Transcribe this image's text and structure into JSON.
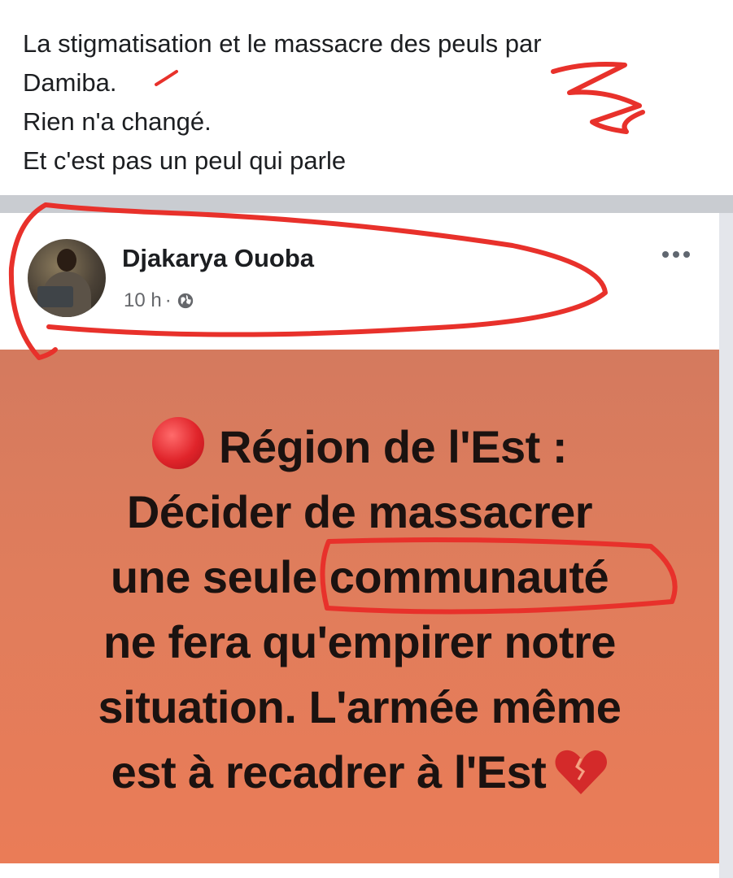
{
  "caption": {
    "lines": [
      "La stigmatisation et le massacre des peuls par",
      "Damiba.",
      "Rien n'a changé.",
      "Et c'est pas un peul qui parle"
    ]
  },
  "post": {
    "author": "Djakarya Ouoba",
    "time": "10 h",
    "separator": "·",
    "privacy_icon": "globe-icon",
    "more_icon": "more-options-icon",
    "image_text": {
      "line1": "Région de l'Est :",
      "line2": "Décider de massacrer",
      "line3_start": "une seule ",
      "line3_highlight": "communauté",
      "line4": "ne fera qu'empirer notre",
      "line5": "situation. L'armée même",
      "line6": "est à recadrer à l'Est"
    },
    "icons": {
      "leading": "red-circle-icon",
      "trailing": "broken-heart-icon"
    }
  },
  "colors": {
    "annotation_red": "#e8312b",
    "image_background": "#e07d5c",
    "name_text": "#1c1e21",
    "meta_text": "#65676b"
  }
}
